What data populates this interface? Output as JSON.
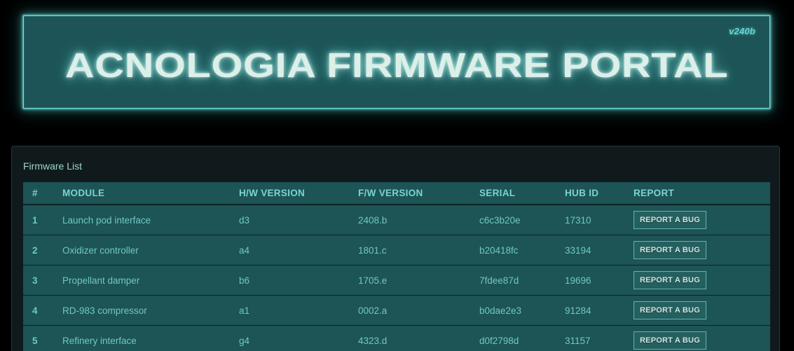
{
  "banner": {
    "title": "ACNOLOGIA FIRMWARE PORTAL",
    "version": "v240b"
  },
  "panel": {
    "title": "Firmware List"
  },
  "table": {
    "columns": [
      {
        "key": "num",
        "label": "#"
      },
      {
        "key": "mod",
        "label": "MODULE"
      },
      {
        "key": "hw",
        "label": "H/W VERSION"
      },
      {
        "key": "fw",
        "label": "F/W VERSION"
      },
      {
        "key": "ser",
        "label": "SERIAL"
      },
      {
        "key": "hub",
        "label": "HUB ID"
      },
      {
        "key": "rep",
        "label": "REPORT"
      }
    ],
    "rows": [
      {
        "num": "1",
        "mod": "Launch pod interface",
        "hw": "d3",
        "fw": "2408.b",
        "ser": "c6c3b20e",
        "hub": "17310",
        "rep": "REPORT A BUG"
      },
      {
        "num": "2",
        "mod": "Oxidizer controller",
        "hw": "a4",
        "fw": "1801.c",
        "ser": "b20418fc",
        "hub": "33194",
        "rep": "REPORT A BUG"
      },
      {
        "num": "3",
        "mod": "Propellant damper",
        "hw": "b6",
        "fw": "1705.e",
        "ser": "7fdee87d",
        "hub": "19696",
        "rep": "REPORT A BUG"
      },
      {
        "num": "4",
        "mod": "RD-983 compressor",
        "hw": "a1",
        "fw": "0002.a",
        "ser": "b0dae2e3",
        "hub": "91284",
        "rep": "REPORT A BUG"
      },
      {
        "num": "5",
        "mod": "Refinery interface",
        "hw": "g4",
        "fw": "4323.d",
        "ser": "d0f2798d",
        "hub": "31157",
        "rep": "REPORT A BUG"
      }
    ]
  },
  "colors": {
    "page_background": "#000000",
    "banner_fill": "#1d5457",
    "banner_border_glow": "#6fe3de",
    "banner_title_text": "#dcefe9",
    "panel_fill": "#101a1c",
    "table_fill": "#1d5456",
    "table_header_text": "#7cd3cf",
    "table_body_text": "#6fc8c4",
    "button_fill": "#24605f",
    "button_border": "#64b4ae"
  }
}
